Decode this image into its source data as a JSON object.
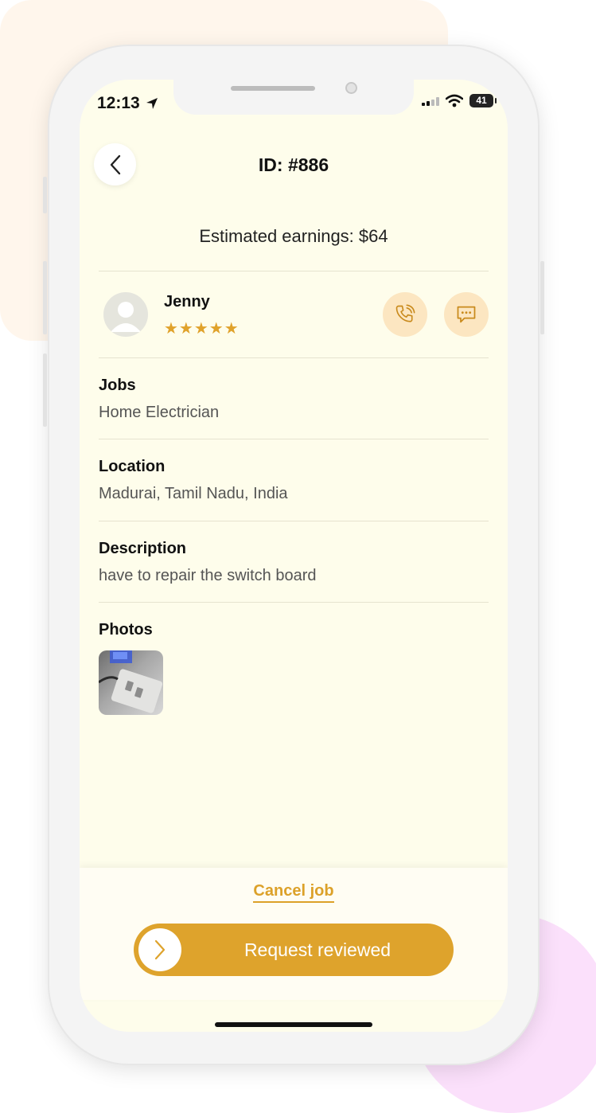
{
  "status_bar": {
    "time": "12:13",
    "battery": "41"
  },
  "header": {
    "title": "ID: #886"
  },
  "earnings": "Estimated earnings: $64",
  "customer": {
    "name": "Jenny",
    "rating_stars": "★★★★★",
    "rating": 5
  },
  "sections": [
    {
      "label": "Jobs",
      "value": "Home Electrician"
    },
    {
      "label": "Location",
      "value": "Madurai, Tamil Nadu, India"
    },
    {
      "label": "Description",
      "value": "have to repair the switch board"
    }
  ],
  "photos": {
    "label": "Photos"
  },
  "footer": {
    "cancel_label": "Cancel job",
    "cta_label": "Request reviewed"
  },
  "colors": {
    "accent": "#dea32c",
    "screen_bg": "#fefdeb",
    "action_bg": "#fce6c1",
    "star": "#e0a22b"
  }
}
